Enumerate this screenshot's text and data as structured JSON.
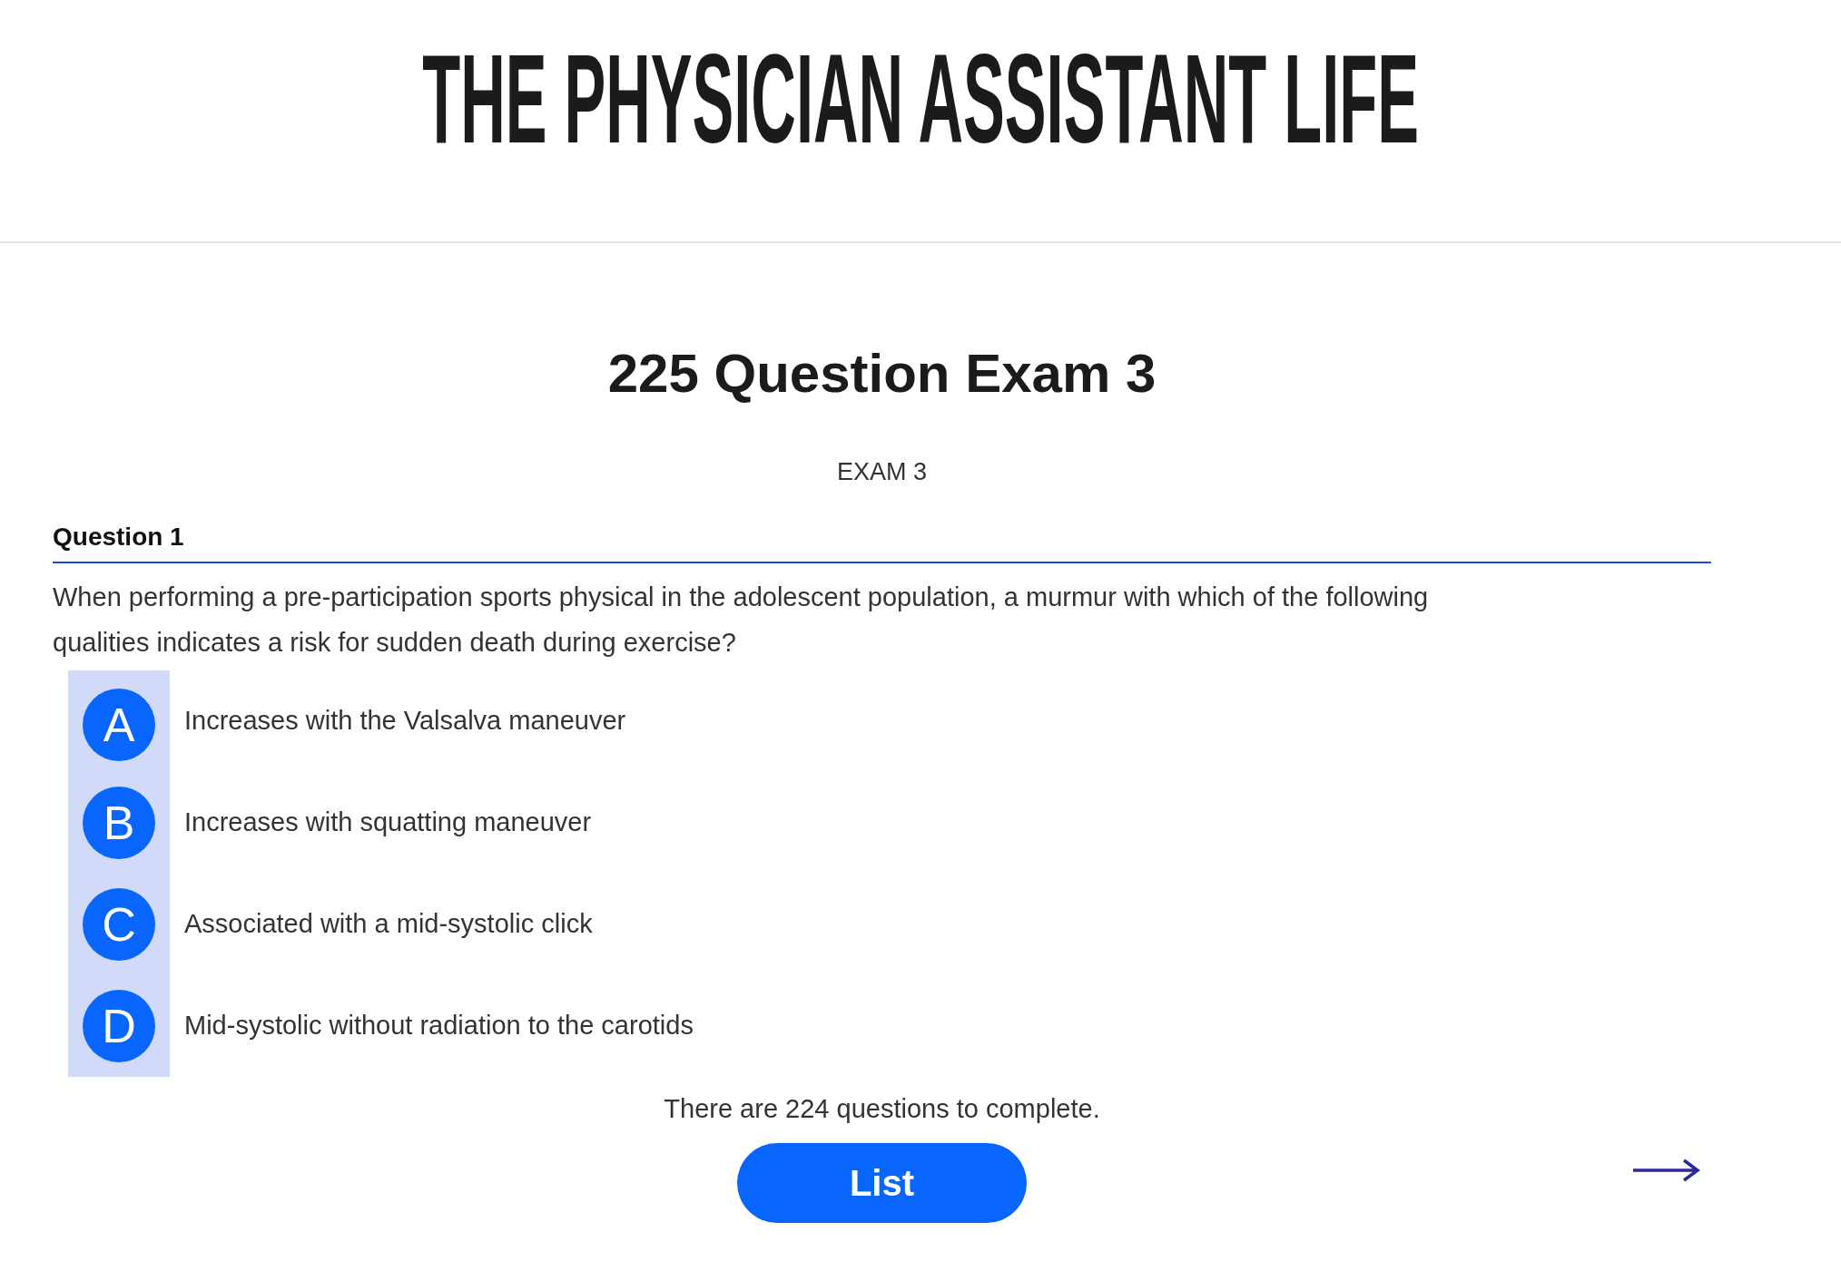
{
  "site_title": "THE PHYSICIAN ASSISTANT LIFE",
  "exam_title": "225 Question Exam 3",
  "exam_subtitle": "EXAM 3",
  "question": {
    "label": "Question 1",
    "text": "When performing a pre-participation sports physical in the adolescent population, a murmur with which of the following qualities indicates a risk for sudden death during exercise?",
    "options": [
      {
        "letter": "A",
        "text": "Increases with the Valsalva maneuver"
      },
      {
        "letter": "B",
        "text": "Increases with squatting maneuver"
      },
      {
        "letter": "C",
        "text": "Associated with a mid-systolic click"
      },
      {
        "letter": "D",
        "text": "Mid-systolic without radiation to the carotids"
      }
    ]
  },
  "remaining": "There are 224 questions to complete.",
  "list_button": "List"
}
